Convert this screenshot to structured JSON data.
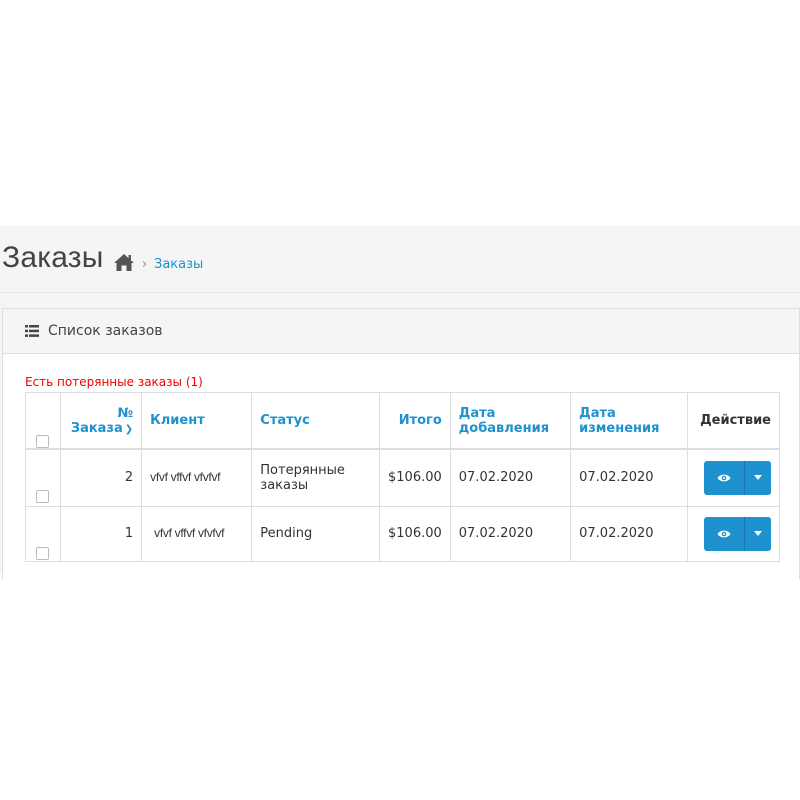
{
  "header": {
    "title": "Заказы",
    "breadcrumb": {
      "home_icon": "home-icon",
      "separator": "›",
      "current": "Заказы"
    }
  },
  "panel": {
    "icon": "list-icon",
    "title": "Список заказов",
    "warning": "Есть потерянные заказы (1)"
  },
  "table": {
    "headers": {
      "order_no_line1": "№",
      "order_no_line2": "Заказа",
      "client": "Клиент",
      "status": "Статус",
      "total": "Итого",
      "date_added_line1": "Дата",
      "date_added_line2": "добавления",
      "date_modified_line1": "Дата",
      "date_modified_line2": "изменения",
      "action": "Действие"
    },
    "rows": [
      {
        "order_id": "2",
        "client": "vfvf vffvf vfvfvf",
        "status_line1": "Потерянные",
        "status_line2": "заказы",
        "total": "$106.00",
        "date_added": "07.02.2020",
        "date_modified": "07.02.2020"
      },
      {
        "order_id": "1",
        "client": "vfvf vffvf vfvfvf",
        "status_line1": "Pending",
        "status_line2": "",
        "total": "$106.00",
        "date_added": "07.02.2020",
        "date_modified": "07.02.2020"
      }
    ]
  },
  "colors": {
    "accent": "#1e91cf",
    "warning": "#ee0000",
    "header_bg": "#f5f5f5"
  },
  "icons": {
    "view": "eye-icon",
    "dropdown": "caret-down-icon",
    "sort": "chevron-down-icon"
  }
}
